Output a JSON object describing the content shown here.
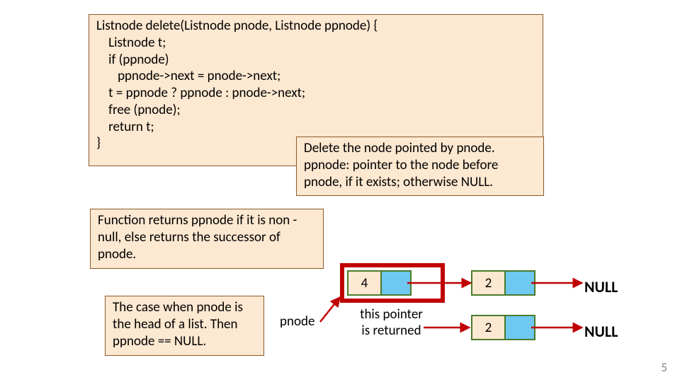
{
  "code": "Listnode delete(Listnode pnode, Listnode ppnode) {\n    Listnode t;\n    if (ppnode)\n       ppnode->next = pnode->next;\n    t = ppnode ? ppnode : pnode->next;\n    free (pnode);\n    return t;\n}",
  "desc": "Delete the node pointed by pnode. ppnode: pointer to the node before pnode, if it exists; otherwise NULL.",
  "return_note": "Function returns ppnode if it is  non -null, else returns the successor of pnode.",
  "case_note": "The case when pnode is the head of a list. Then ppnode == NULL.",
  "diagram": {
    "pnode_label": "pnode",
    "returned_label": "this pointer is returned",
    "null1": "NULL",
    "null2": "NULL",
    "top_row": {
      "n1": "4",
      "n2": "2"
    },
    "bot_row": {
      "n2": "2"
    }
  },
  "page": "5"
}
